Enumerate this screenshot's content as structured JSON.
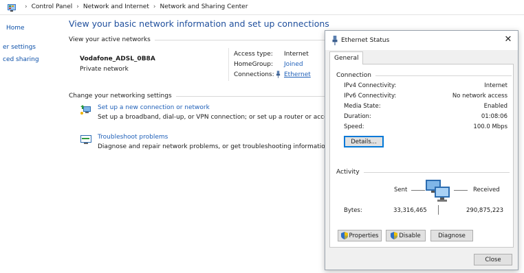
{
  "breadcrumb": {
    "items": [
      "Control Panel",
      "Network and Internet",
      "Network and Sharing Center"
    ]
  },
  "leftnav": {
    "items": [
      "Home",
      "er settings",
      "ced sharing"
    ]
  },
  "main": {
    "title": "View your basic network information and set up connections",
    "active_networks_label": "View your active networks",
    "network_name": "Vodafone_ADSL_0B8A",
    "network_type": "Private network",
    "access_type_label": "Access type:",
    "access_type_value": "Internet",
    "homegroup_label": "HomeGroup:",
    "homegroup_value": "Joined",
    "connections_label": "Connections:",
    "connections_value": "Ethernet",
    "change_settings_label": "Change your networking settings",
    "tasks": [
      {
        "link": "Set up a new connection or network",
        "desc": "Set up a broadband, dial-up, or VPN connection; or set up a router or access point."
      },
      {
        "link": "Troubleshoot problems",
        "desc": "Diagnose and repair network problems, or get troubleshooting information."
      }
    ]
  },
  "dialog": {
    "title": "Ethernet Status",
    "tab": "General",
    "connection_label": "Connection",
    "rows": [
      {
        "label": "IPv4 Connectivity:",
        "value": "Internet"
      },
      {
        "label": "IPv6 Connectivity:",
        "value": "No network access"
      },
      {
        "label": "Media State:",
        "value": "Enabled"
      },
      {
        "label": "Duration:",
        "value": "01:08:06"
      },
      {
        "label": "Speed:",
        "value": "100.0 Mbps"
      }
    ],
    "details_button": "Details...",
    "activity_label": "Activity",
    "sent_label": "Sent",
    "received_label": "Received",
    "bytes_label": "Bytes:",
    "bytes_sent": "33,316,465",
    "bytes_received": "290,875,223",
    "properties_button": "Properties",
    "disable_button": "Disable",
    "diagnose_button": "Diagnose",
    "close_button": "Close"
  },
  "colors": {
    "link": "#1e5fb8",
    "title_blue": "#1e4e9c",
    "dialog_bg": "#f0f0f0",
    "focus_blue": "#0078d7"
  }
}
